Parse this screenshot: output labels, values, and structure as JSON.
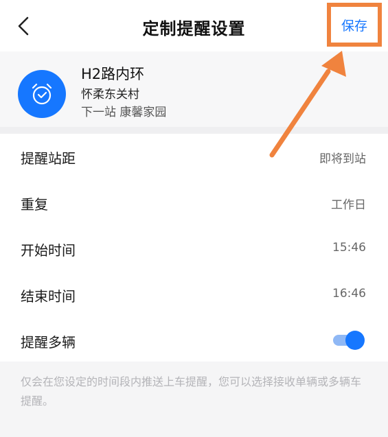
{
  "header": {
    "title": "定制提醒设置",
    "back_icon": "chevron-left-icon",
    "save_label": "保存"
  },
  "route": {
    "icon": "alarm-clock-icon",
    "name": "H2路内环",
    "direction": "怀柔东关村",
    "next_stop": "下一站 康馨家园"
  },
  "settings": {
    "distance": {
      "label": "提醒站距",
      "value": "即将到站"
    },
    "repeat": {
      "label": "重复",
      "value": "工作日"
    },
    "start_time": {
      "label": "开始时间",
      "value": "15:46"
    },
    "end_time": {
      "label": "结束时间",
      "value": "16:46"
    },
    "multi_vehicle": {
      "label": "提醒多辆",
      "enabled": true
    }
  },
  "footer": {
    "note": "仅会在您设定的时间段内推送上车提醒，您可以选择接收单辆或多辆车提醒。"
  },
  "colors": {
    "accent": "#1677ff",
    "highlight": "#f0833e"
  }
}
